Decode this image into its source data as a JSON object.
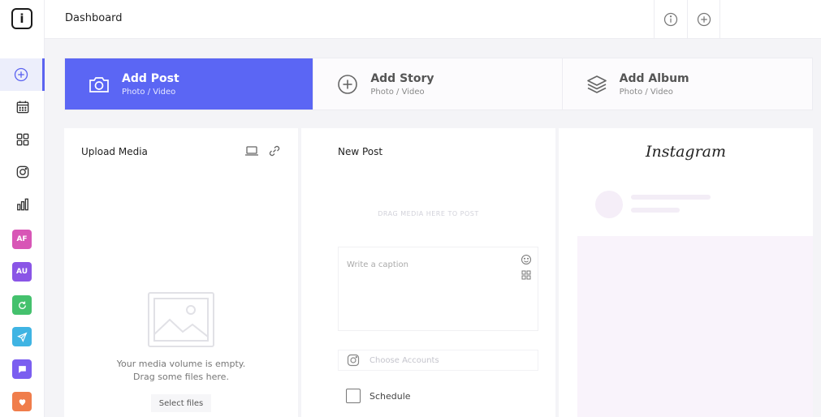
{
  "header": {
    "title": "Dashboard",
    "actions": [
      {
        "icon": "info-circle-icon"
      },
      {
        "icon": "plus-circle-icon"
      }
    ]
  },
  "sidebar": {
    "logo_glyph": "i",
    "items": [
      {
        "icon": "plus-circle-icon",
        "active": true
      },
      {
        "icon": "calendar-icon"
      },
      {
        "icon": "grid-icon"
      },
      {
        "icon": "instagram-icon"
      },
      {
        "icon": "bar-chart-icon"
      }
    ],
    "apps": [
      {
        "label": "AF",
        "color": "#d856b6"
      },
      {
        "label": "AU",
        "color": "#8a55e6"
      },
      {
        "icon": "refresh-icon",
        "color": "#44c16d"
      },
      {
        "icon": "send-icon",
        "color": "#3fb4e3"
      },
      {
        "icon": "chat-icon",
        "color": "#7b5ef0"
      },
      {
        "icon": "heart-icon",
        "color": "#f07d4b"
      }
    ]
  },
  "tabs": [
    {
      "title": "Add Post",
      "subtitle": "Photo / Video",
      "icon": "camera-icon",
      "active": true
    },
    {
      "title": "Add Story",
      "subtitle": "Photo / Video",
      "icon": "plus-circle-icon",
      "active": false
    },
    {
      "title": "Add Album",
      "subtitle": "Photo / Video",
      "icon": "layers-icon",
      "active": false
    }
  ],
  "upload": {
    "title": "Upload Media",
    "empty_line1": "Your media volume is empty.",
    "empty_line2": "Drag some files here.",
    "select_label": "Select files"
  },
  "new_post": {
    "title": "New Post",
    "drag_hint": "DRAG MEDIA HERE TO POST",
    "caption_placeholder": "Write a caption",
    "accounts_placeholder": "Choose Accounts",
    "schedule_label": "Schedule"
  },
  "preview": {
    "brand": "Instagram"
  },
  "colors": {
    "accent": "#5b66f4",
    "active_bg": "#eceefb"
  }
}
